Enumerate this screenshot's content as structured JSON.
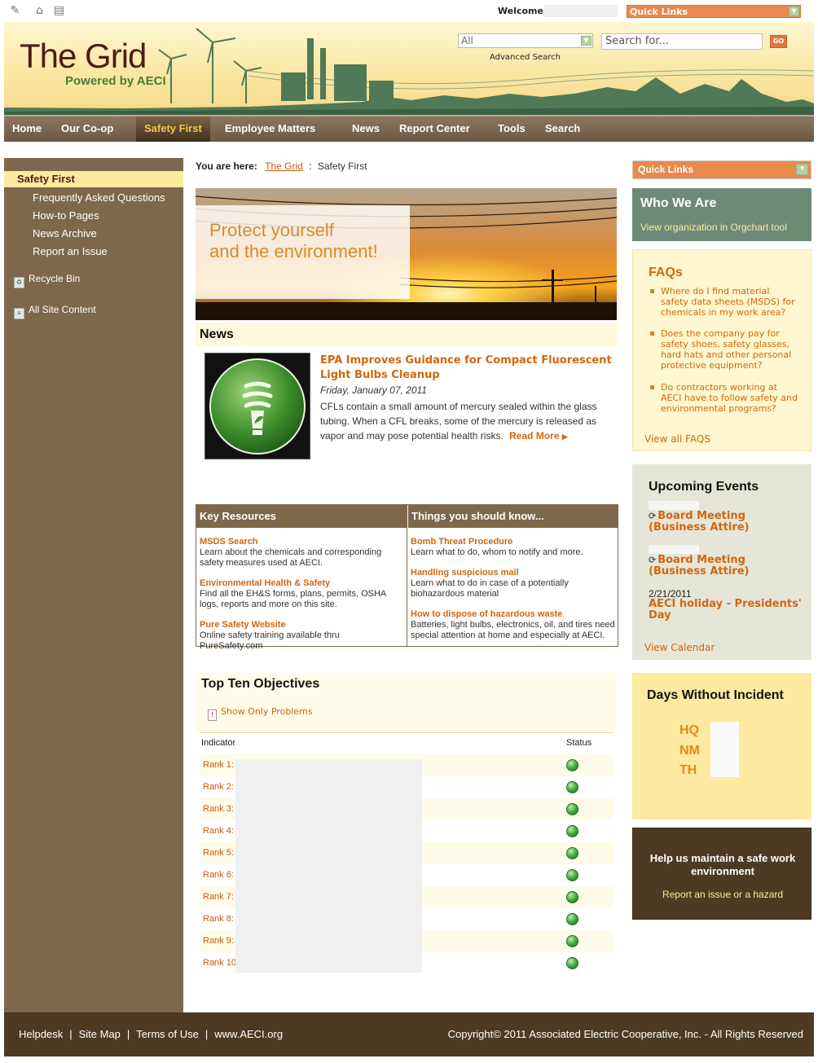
{
  "topbar": {
    "welcome": "Welcome,",
    "quick_links": "Quick Links"
  },
  "header": {
    "logo_title": "The Grid",
    "logo_subtitle": "Powered by AECI",
    "scope_value": "All",
    "search_placeholder": "Search for...",
    "go_label": "GO",
    "advanced_search": "Advanced Search"
  },
  "nav": {
    "items": [
      {
        "label": "Home"
      },
      {
        "label": "Our Co-op"
      },
      {
        "label": "Safety First"
      },
      {
        "label": "Employee Matters"
      },
      {
        "label": "News"
      },
      {
        "label": "Report Center"
      },
      {
        "label": "Tools"
      },
      {
        "label": "Search"
      }
    ]
  },
  "sidebar": {
    "heading": "Safety First",
    "links": [
      {
        "label": "Frequently Asked Questions"
      },
      {
        "label": "How-to Pages"
      },
      {
        "label": "News Archive"
      },
      {
        "label": "Report an Issue"
      }
    ],
    "recycle_bin": "Recycle Bin",
    "all_site_content": "All Site Content"
  },
  "breadcrumb": {
    "label": "You are here:",
    "root": "The Grid",
    "separator": ":",
    "current": "Safety First"
  },
  "hero": {
    "line1": "Protect yourself",
    "line2": "and the environment!"
  },
  "news": {
    "heading": "News",
    "title": "EPA Improves Guidance for Compact Fluorescent Light Bulbs Cleanup",
    "date": "Friday, January 07, 2011",
    "body": "CFLs contain a small amount of mercury sealed within the glass tubing. When a CFL breaks, some of the mercury is released as vapor and may pose potential health risks.",
    "read_more": "Read More"
  },
  "resources": {
    "col1_heading": "Key Resources",
    "col2_heading": "Things you should know...",
    "col1": [
      {
        "title": "MSDS Search",
        "desc": "Learn about the chemicals and corresponding safety measures used at AECI."
      },
      {
        "title": "Environmental Health & Safety",
        "desc": "Find all the EH&S forms, plans, permits, OSHA logs, reports and more on this site."
      },
      {
        "title": "Pure Safety Website",
        "desc": "Online safety training available thru PureSafety.com"
      }
    ],
    "col2": [
      {
        "title": "Bomb Threat Procedure",
        "desc": "Learn what to do, whom to notify and more."
      },
      {
        "title": "Handling suspicious mail",
        "desc": "Learn what to do in case of a potentially biohazardous material"
      },
      {
        "title": "How to dispose of hazardous waste",
        "desc": "Batteries, light bulbs, electronics, oil, and tires need special attention at home and especially at AECI."
      }
    ]
  },
  "objectives": {
    "title": "Top Ten Objectives",
    "filter": "Show Only Problems",
    "col_indicator": "Indicator",
    "col_status": "Status",
    "rows": [
      {
        "rank": "Rank 1:",
        "status": "green"
      },
      {
        "rank": "Rank 2:",
        "status": "green"
      },
      {
        "rank": "Rank 3:",
        "status": "green"
      },
      {
        "rank": "Rank 4:",
        "status": "green"
      },
      {
        "rank": "Rank 5:",
        "status": "green"
      },
      {
        "rank": "Rank 6:",
        "status": "green"
      },
      {
        "rank": "Rank 7:",
        "status": "green"
      },
      {
        "rank": "Rank 8:",
        "status": "green"
      },
      {
        "rank": "Rank 9:",
        "status": "green"
      },
      {
        "rank": "Rank 10",
        "status": "green"
      }
    ]
  },
  "right": {
    "quick_links": "Quick Links",
    "who_heading": "Who We Are",
    "who_link": "View organization in Orgchart tool",
    "faqs_heading": "FAQs",
    "faqs": [
      {
        "q": "Where do I find material safety data sheets (MSDS) for chemicals in my work area?"
      },
      {
        "q": "Does the company pay for safety shoes, safety glasses, hard hats and other personal protective equipment?"
      },
      {
        "q": "Do contractors working at AECI have to follow safety and environmental programs?"
      }
    ],
    "faqs_all": "View all FAQS",
    "events_heading": "Upcoming Events",
    "events": [
      {
        "title": "Board Meeting (Business Attire)",
        "date": ""
      },
      {
        "title": "Board Meeting (Business Attire)",
        "date": ""
      },
      {
        "title": "AECI holiday - Presidents' Day",
        "date": "2/21/2011"
      }
    ],
    "events_calendar": "View Calendar",
    "days_heading": "Days Without Incident",
    "days_labels": [
      "HQ",
      "NM",
      "TH"
    ],
    "help_title": "Help us maintain a safe work environment",
    "help_link": "Report an issue or a hazard"
  },
  "footer": {
    "links": [
      "Helpdesk",
      "Site Map",
      "Terms of Use",
      "www.AECI.org"
    ],
    "separator": "|",
    "copyright": "Copyright© 2011 Associated Electric Cooperative, Inc. - All Rights Reserved"
  },
  "colors": {
    "brand_brown": "#7f674b",
    "accent_orange": "#d2660f",
    "nav_active": "#f6c544",
    "status_green": "#37a63c"
  }
}
